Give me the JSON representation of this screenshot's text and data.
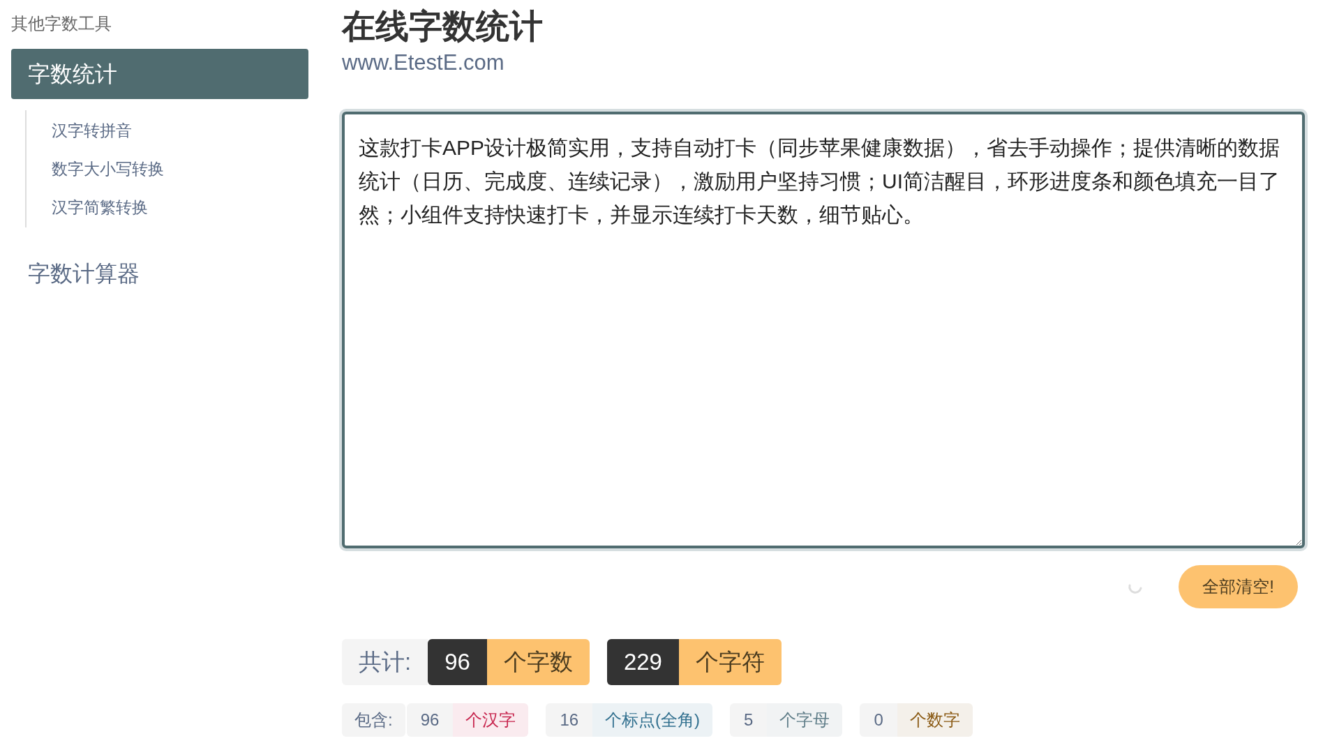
{
  "sidebar": {
    "heading": "其他字数工具",
    "items": [
      {
        "label": "字数统计",
        "selected": true,
        "children": [
          {
            "label": "汉字转拼音",
            "selected": false
          },
          {
            "label": "数字大小写转换",
            "selected": false
          },
          {
            "label": "汉字简繁转换",
            "selected": false
          }
        ]
      },
      {
        "label": "字数计算器",
        "selected": false
      }
    ]
  },
  "header": {
    "title": "在线字数统计",
    "url": "www.EtestE.com"
  },
  "editor": {
    "value": "这款打卡APP设计极简实用，支持自动打卡（同步苹果健康数据），省去手动操作；提供清晰的数据统计（日历、完成度、连续记录），激励用户坚持习惯；UI简洁醒目，环形进度条和颜色填充一目了然；小组件支持快速打卡，并显示连续打卡天数，细节贴心。"
  },
  "clear_button": "全部清空!",
  "totals": {
    "label": "共计:",
    "items": [
      {
        "count": "96",
        "unit": "个字数"
      },
      {
        "count": "229",
        "unit": "个字符"
      }
    ]
  },
  "breakdown": {
    "label": "包含:",
    "items": [
      {
        "count": "96",
        "unit": "个汉字",
        "color": "#c7254e"
      },
      {
        "count": "16",
        "unit": "个标点(全角)",
        "color": "#31708f"
      },
      {
        "count": "5",
        "unit": "个字母",
        "color": "#5f7d88"
      },
      {
        "count": "0",
        "unit": "个数字",
        "color": "#8a5a14"
      }
    ]
  }
}
